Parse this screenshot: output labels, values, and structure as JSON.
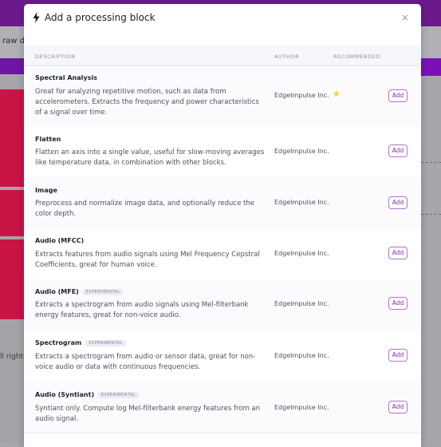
{
  "background": {
    "raw_data_fragment": "raw da",
    "rights_fragment": "ll rights"
  },
  "modal": {
    "title": "Add a processing block",
    "close_label": "×",
    "icon": "bolt-icon"
  },
  "table": {
    "headers": {
      "description": "DESCRIPTION",
      "author": "AUTHOR",
      "recommended": "RECOMMENDED"
    },
    "experimental_label": "EXPERIMENTAL",
    "add_label": "Add",
    "rows": [
      {
        "title": "Spectral Analysis",
        "description": "Great for analyzing repetitive motion, such as data from accelerometers. Extracts the frequency and power characteristics of a signal over time.",
        "author": "EdgeImpulse Inc.",
        "recommended": true,
        "experimental": false
      },
      {
        "title": "Flatten",
        "description": "Flatten an axis into a single value, useful for slow-moving averages like temperature data, in combination with other blocks.",
        "author": "EdgeImpulse Inc.",
        "recommended": false,
        "experimental": false
      },
      {
        "title": "Image",
        "description": "Preprocess and normalize image data, and optionally reduce the color depth.",
        "author": "EdgeImpulse Inc.",
        "recommended": false,
        "experimental": false
      },
      {
        "title": "Audio (MFCC)",
        "description": "Extracts features from audio signals using Mel Frequency Cepstral Coefficients, great for human voice.",
        "author": "EdgeImpulse Inc.",
        "recommended": false,
        "experimental": false
      },
      {
        "title": "Audio (MFE)",
        "description": "Extracts a spectrogram from audio signals using Mel-filterbank energy features, great for non-voice audio.",
        "author": "EdgeImpulse Inc.",
        "recommended": false,
        "experimental": true
      },
      {
        "title": "Spectrogram",
        "description": "Extracts a spectrogram from audio or sensor data, great for non-voice audio or data with continuous frequencies.",
        "author": "EdgeImpulse Inc.",
        "recommended": false,
        "experimental": true
      },
      {
        "title": "Audio (Syntiant)",
        "description": "Syntiant only. Compute log Mel-filterbank energy features from an audio signal.",
        "author": "EdgeImpulse Inc.",
        "recommended": false,
        "experimental": true
      }
    ]
  },
  "colors": {
    "accent": "#7b2fa4",
    "star": "#f2d40c",
    "topbar": "#6b1a8c"
  }
}
